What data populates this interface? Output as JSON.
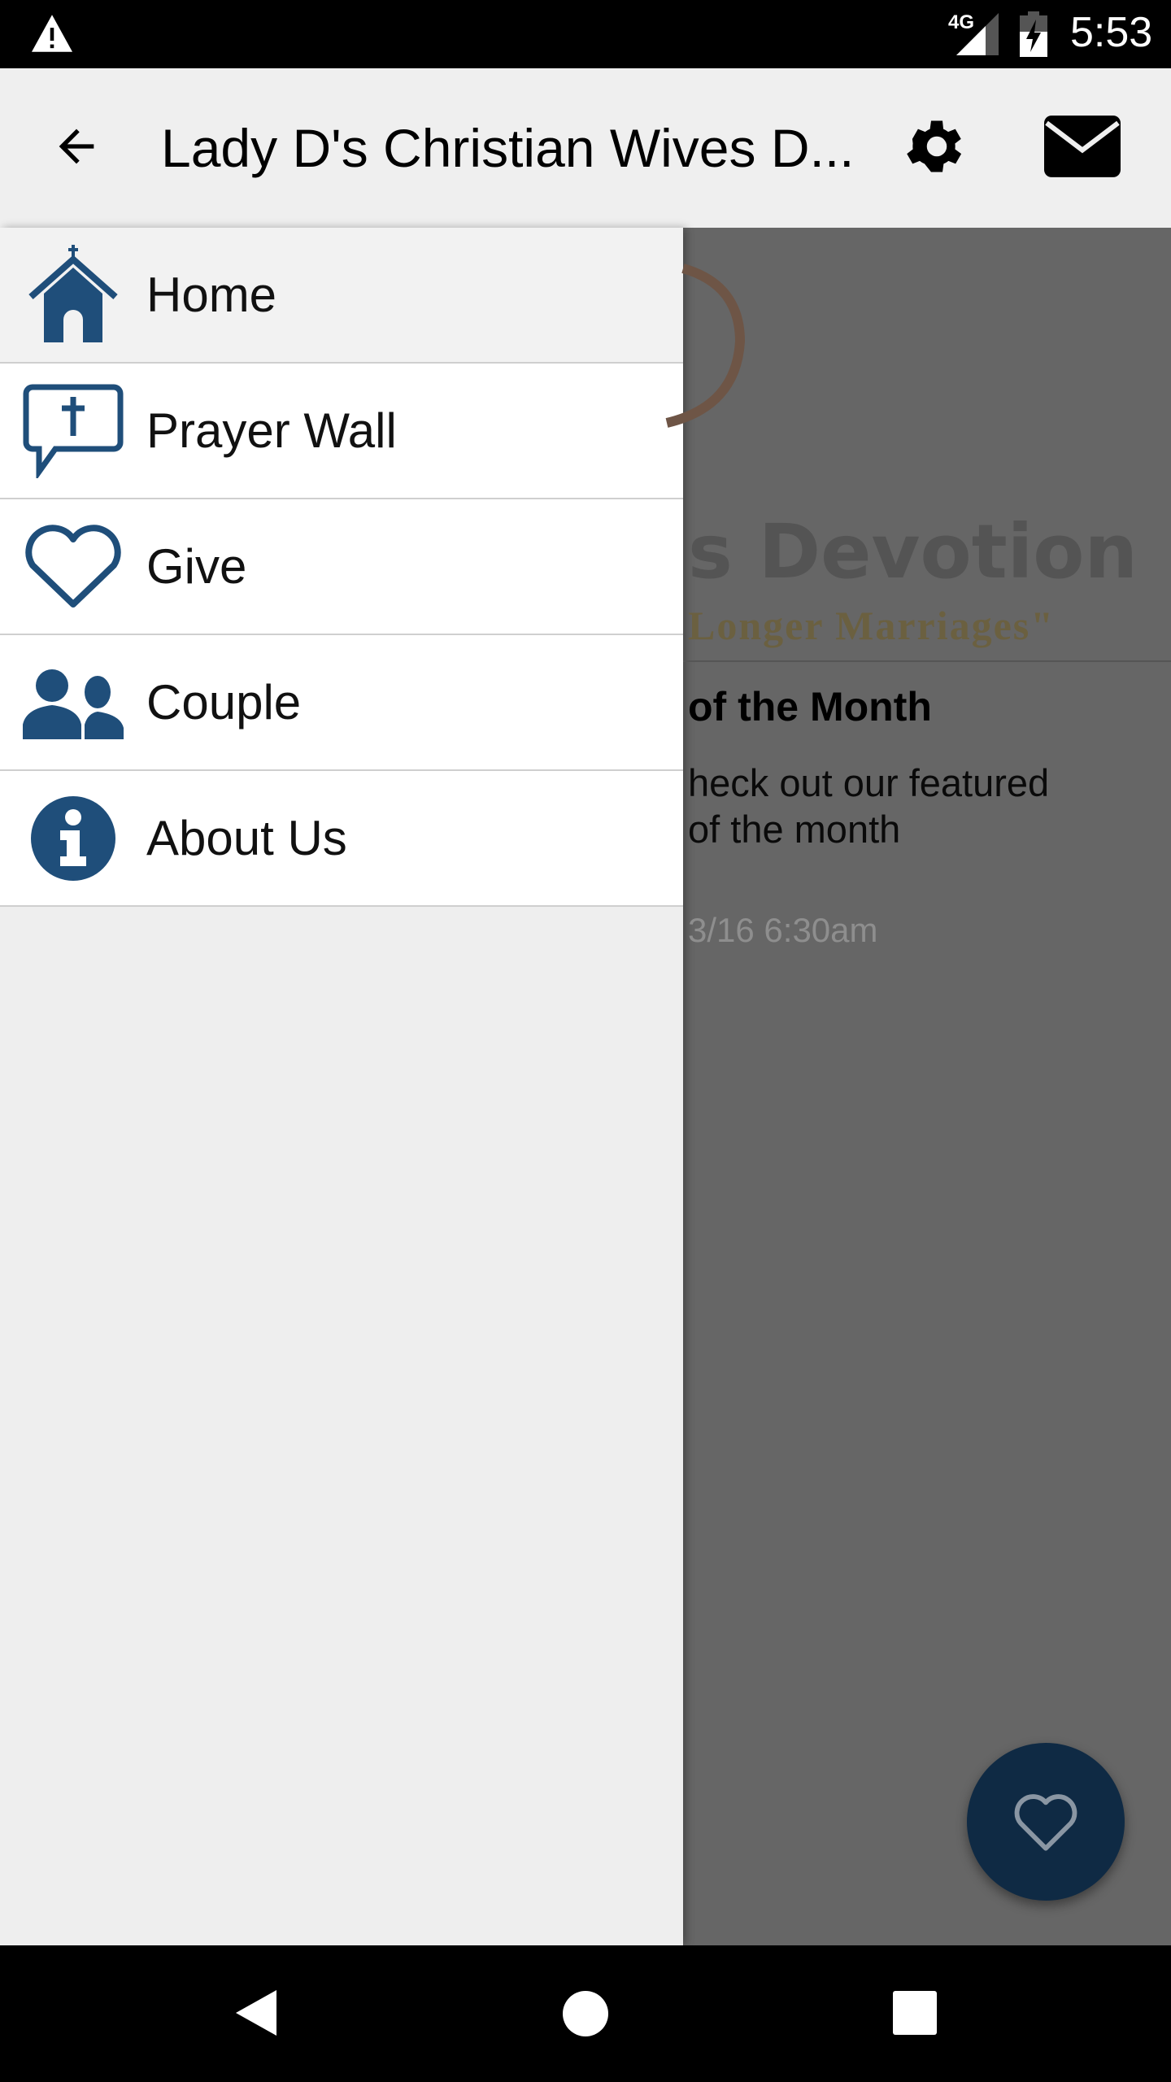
{
  "status_bar": {
    "time": "5:53",
    "network": "4G",
    "icons": [
      "warning-icon",
      "signal-icon",
      "battery-charging-icon"
    ]
  },
  "app_bar": {
    "title": "Lady D's Christian Wives D...",
    "icons": [
      "back-arrow-icon",
      "gear-icon",
      "mail-icon"
    ]
  },
  "drawer": {
    "items": [
      {
        "label": "Home",
        "icon": "church-icon",
        "selected": true
      },
      {
        "label": "Prayer Wall",
        "icon": "prayer-bubble-icon"
      },
      {
        "label": "Give",
        "icon": "heart-icon"
      },
      {
        "label": "Couple",
        "icon": "couple-icon"
      },
      {
        "label": "About Us",
        "icon": "info-icon"
      }
    ]
  },
  "background": {
    "logo_title": "s Devotion",
    "logo_tagline": "Longer Marriages\"",
    "post_title": "of the Month",
    "post_body_1": "heck out our featured",
    "post_body_2": "of the month",
    "post_date": "3/16 6:30am"
  },
  "fab": {
    "icon": "heart-icon"
  },
  "colors": {
    "accent": "#1f4e7a",
    "fab": "#0f2a44",
    "logo_brown": "#8b5a3c"
  }
}
